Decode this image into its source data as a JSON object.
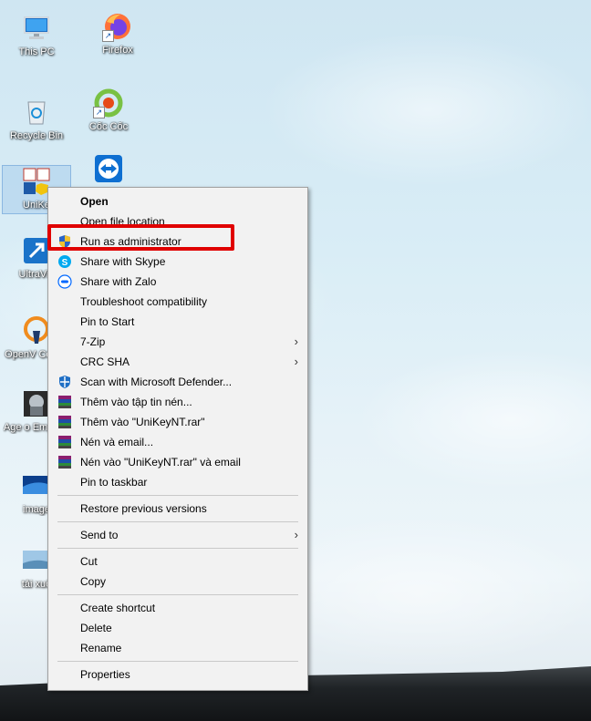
{
  "desktop": {
    "icons": [
      {
        "id": "this-pc",
        "label": "This PC"
      },
      {
        "id": "firefox",
        "label": "Firefox"
      },
      {
        "id": "recycle-bin",
        "label": "Recycle Bin"
      },
      {
        "id": "coc-coc",
        "label": "Cốc Cốc"
      },
      {
        "id": "unikey",
        "label": "UniKe"
      },
      {
        "id": "teamviewer",
        "label": ""
      },
      {
        "id": "ultraviewer",
        "label": "UltraVie"
      },
      {
        "id": "openvpn",
        "label": "OpenV Conne"
      },
      {
        "id": "age-of-empires",
        "label": "Age o Empires"
      },
      {
        "id": "image",
        "label": "image"
      },
      {
        "id": "tai-xuong",
        "label": "tải xuố"
      }
    ]
  },
  "context_menu": {
    "items": [
      {
        "label": "Open",
        "bold": true
      },
      {
        "label": "Open file location"
      },
      {
        "label": "Run as administrator",
        "icon": "uac-shield-icon"
      },
      {
        "label": "Share with Skype",
        "icon": "skype-icon"
      },
      {
        "label": "Share with Zalo",
        "icon": "zalo-icon"
      },
      {
        "label": "Troubleshoot compatibility"
      },
      {
        "label": "Pin to Start"
      },
      {
        "label": "7-Zip",
        "submenu": true
      },
      {
        "label": "CRC SHA",
        "submenu": true
      },
      {
        "label": "Scan with Microsoft Defender...",
        "icon": "defender-icon"
      },
      {
        "label": "Thêm vào tập tin nén...",
        "icon": "winrar-icon"
      },
      {
        "label": "Thêm vào \"UniKeyNT.rar\"",
        "icon": "winrar-icon"
      },
      {
        "label": "Nén và email...",
        "icon": "winrar-icon"
      },
      {
        "label": "Nén vào \"UniKeyNT.rar\" và email",
        "icon": "winrar-icon"
      },
      {
        "label": "Pin to taskbar"
      },
      {
        "label": "Restore previous versions"
      },
      {
        "label": "Send to",
        "submenu": true
      },
      {
        "label": "Cut"
      },
      {
        "label": "Copy"
      },
      {
        "label": "Create shortcut"
      },
      {
        "label": "Delete"
      },
      {
        "label": "Rename"
      },
      {
        "label": "Properties"
      }
    ],
    "submenu_arrow": "›"
  },
  "annotation": {
    "highlight_color": "#e00000",
    "highlighted_item": "Run as administrator"
  }
}
